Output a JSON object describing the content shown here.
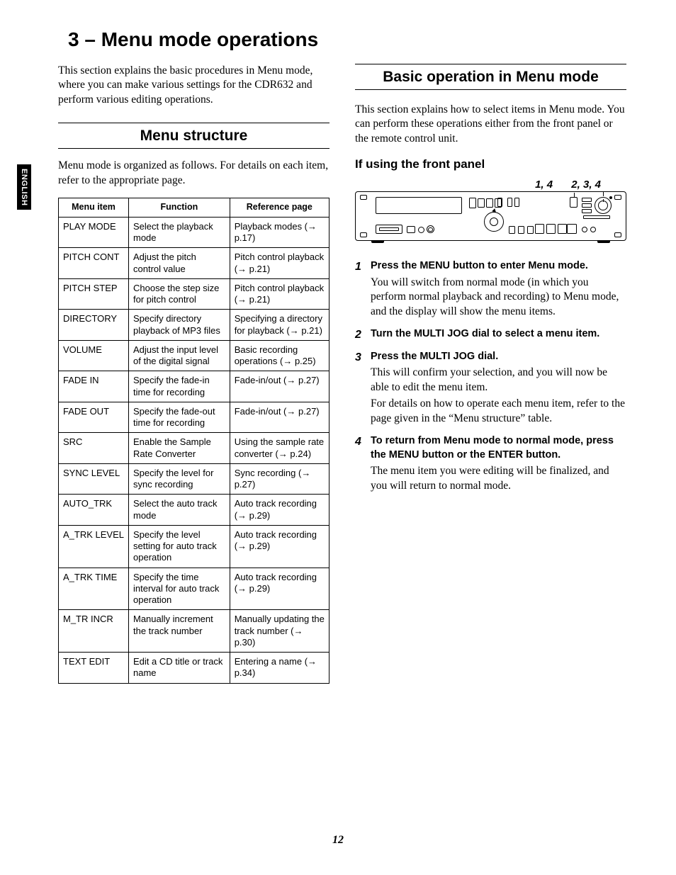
{
  "side_tab": "ENGLISH",
  "chapter_title": "3 – Menu mode operations",
  "left": {
    "intro": "This section explains the basic procedures in Menu mode, where you can make various settings for the CDR632 and perform various editing operations.",
    "section_heading": "Menu structure",
    "body": "Menu mode is organized as follows. For details on each item, refer to the appropriate page.",
    "table": {
      "headers": [
        "Menu item",
        "Function",
        "Reference page"
      ],
      "rows": [
        {
          "item": "PLAY MODE",
          "func": "Select the playback mode",
          "ref": "Playback modes (→ p.17)"
        },
        {
          "item": "PITCH CONT",
          "func": "Adjust the pitch control value",
          "ref": "Pitch control playback (→ p.21)"
        },
        {
          "item": "PITCH STEP",
          "func": "Choose the step size for pitch control",
          "ref": "Pitch control playback (→ p.21)"
        },
        {
          "item": "DIRECTORY",
          "func": "Specify directory playback of MP3 files",
          "ref": "Specifying a directory for playback (→ p.21)"
        },
        {
          "item": "VOLUME",
          "func": "Adjust the input level of the digital signal",
          "ref": "Basic recording operations (→ p.25)"
        },
        {
          "item": "FADE IN",
          "func": "Specify the fade-in time for recording",
          "ref": "Fade-in/out (→ p.27)"
        },
        {
          "item": "FADE OUT",
          "func": "Specify the fade-out time for recording",
          "ref": "Fade-in/out (→ p.27)"
        },
        {
          "item": "SRC",
          "func": "Enable the Sample Rate Converter",
          "ref": "Using the sample rate converter (→ p.24)"
        },
        {
          "item": "SYNC LEVEL",
          "func": "Specify the level for sync recording",
          "ref": "Sync recording (→ p.27)"
        },
        {
          "item": "AUTO_TRK",
          "func": "Select the auto track mode",
          "ref": "Auto track recording (→ p.29)"
        },
        {
          "item": "A_TRK LEVEL",
          "func": "Specify the level setting for auto track operation",
          "ref": "Auto track recording (→ p.29)"
        },
        {
          "item": "A_TRK TIME",
          "func": "Specify the time interval for auto track operation",
          "ref": "Auto track recording (→ p.29)"
        },
        {
          "item": "M_TR INCR",
          "func": "Manually increment the track number",
          "ref": "Manually updating the track number (→ p.30)"
        },
        {
          "item": "TEXT EDIT",
          "func": "Edit a CD title or track name",
          "ref": "Entering a name (→ p.34)"
        }
      ]
    }
  },
  "right": {
    "section_heading": "Basic operation in Menu mode",
    "intro": "This section explains how to select items in Menu mode. You can perform these operations either from the front panel or the remote control unit.",
    "subsection": "If using the front panel",
    "callout_left": "1, 4",
    "callout_right": "2, 3, 4",
    "steps": [
      {
        "lead": "Press the MENU button to enter Menu mode.",
        "paras": [
          "You will switch from normal mode (in which you perform normal playback and recording) to Menu mode, and the display will show the menu items."
        ]
      },
      {
        "lead": "Turn the MULTI JOG dial to select a menu item.",
        "paras": []
      },
      {
        "lead": "Press the MULTI JOG dial.",
        "paras": [
          "This will confirm your selection, and you will now be able to edit the menu item.",
          "For details on how to operate each menu item, refer to the page given in the “Menu structure” table."
        ]
      },
      {
        "lead": "To return from Menu mode to normal mode, press the MENU button or the ENTER button.",
        "paras": [
          "The menu item you were editing will be finalized, and you will return to normal mode."
        ]
      }
    ]
  },
  "page_number": "12"
}
